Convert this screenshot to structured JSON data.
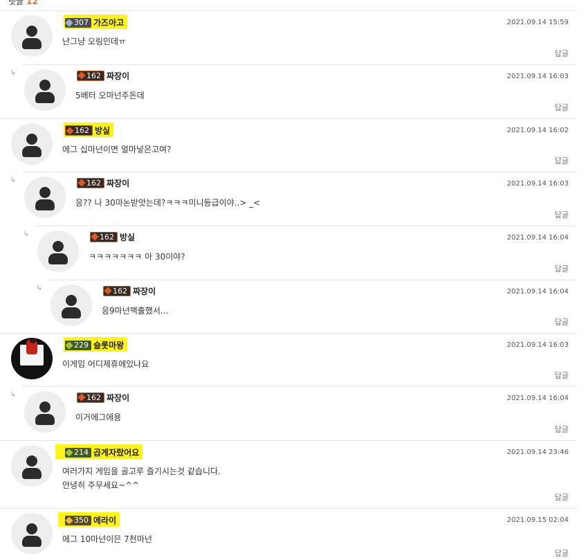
{
  "header": {
    "label": "댓글",
    "count": "12"
  },
  "reply_label": "답글",
  "comments": [
    {
      "level": "307",
      "nick": "가즈아고",
      "date": "2021.09.14 15:59",
      "text": [
        "난그냥 오링인데ㅠ"
      ]
    },
    {
      "level": "162",
      "nick": "짜장이",
      "date": "2021.09.14 16:03",
      "text": [
        "5배터 오마넌주돈데"
      ]
    },
    {
      "level": "162",
      "nick": "방실",
      "date": "2021.09.14 16:02",
      "text": [
        "에그 십마넌이면 얼마넣은고여?"
      ]
    },
    {
      "level": "162",
      "nick": "짜장이",
      "date": "2021.09.14 16:03",
      "text": [
        "응?? 나 30마논받앗는데?ㅋㅋㅋ미니등급이야..> _<"
      ]
    },
    {
      "level": "162",
      "nick": "방실",
      "date": "2021.09.14 16:04",
      "text": [
        "ㅋㅋㅋㅋㅋㅋㅋ 아 30이야?"
      ]
    },
    {
      "level": "162",
      "nick": "짜장이",
      "date": "2021.09.14 16:04",
      "text": [
        "응9마넌맥출했서..."
      ]
    },
    {
      "level": "229",
      "nick": "슬롯마왕",
      "date": "2021.09.14 16:03",
      "text": [
        "이게임 어디제휴에있나요"
      ]
    },
    {
      "level": "162",
      "nick": "짜장이",
      "date": "2021.09.14 16:04",
      "text": [
        "이거에그에용"
      ]
    },
    {
      "level": "214",
      "nick": "곱게자랐어요",
      "date": "2021.09.14 23:46",
      "text": [
        "여러가지 게임을 골고루 즐기시는것 같습니다.",
        "안녕히 주무세요~^^"
      ]
    },
    {
      "level": "350",
      "nick": "에라이",
      "date": "2021.09.15 02:04",
      "text": [
        "에그 10마넌이믄 7천마넌"
      ]
    }
  ],
  "icons": {
    "avatar": "default-avatar-icon",
    "reply_arrow": "reply-arrow-icon",
    "level_gem": "level-gem-icon"
  }
}
